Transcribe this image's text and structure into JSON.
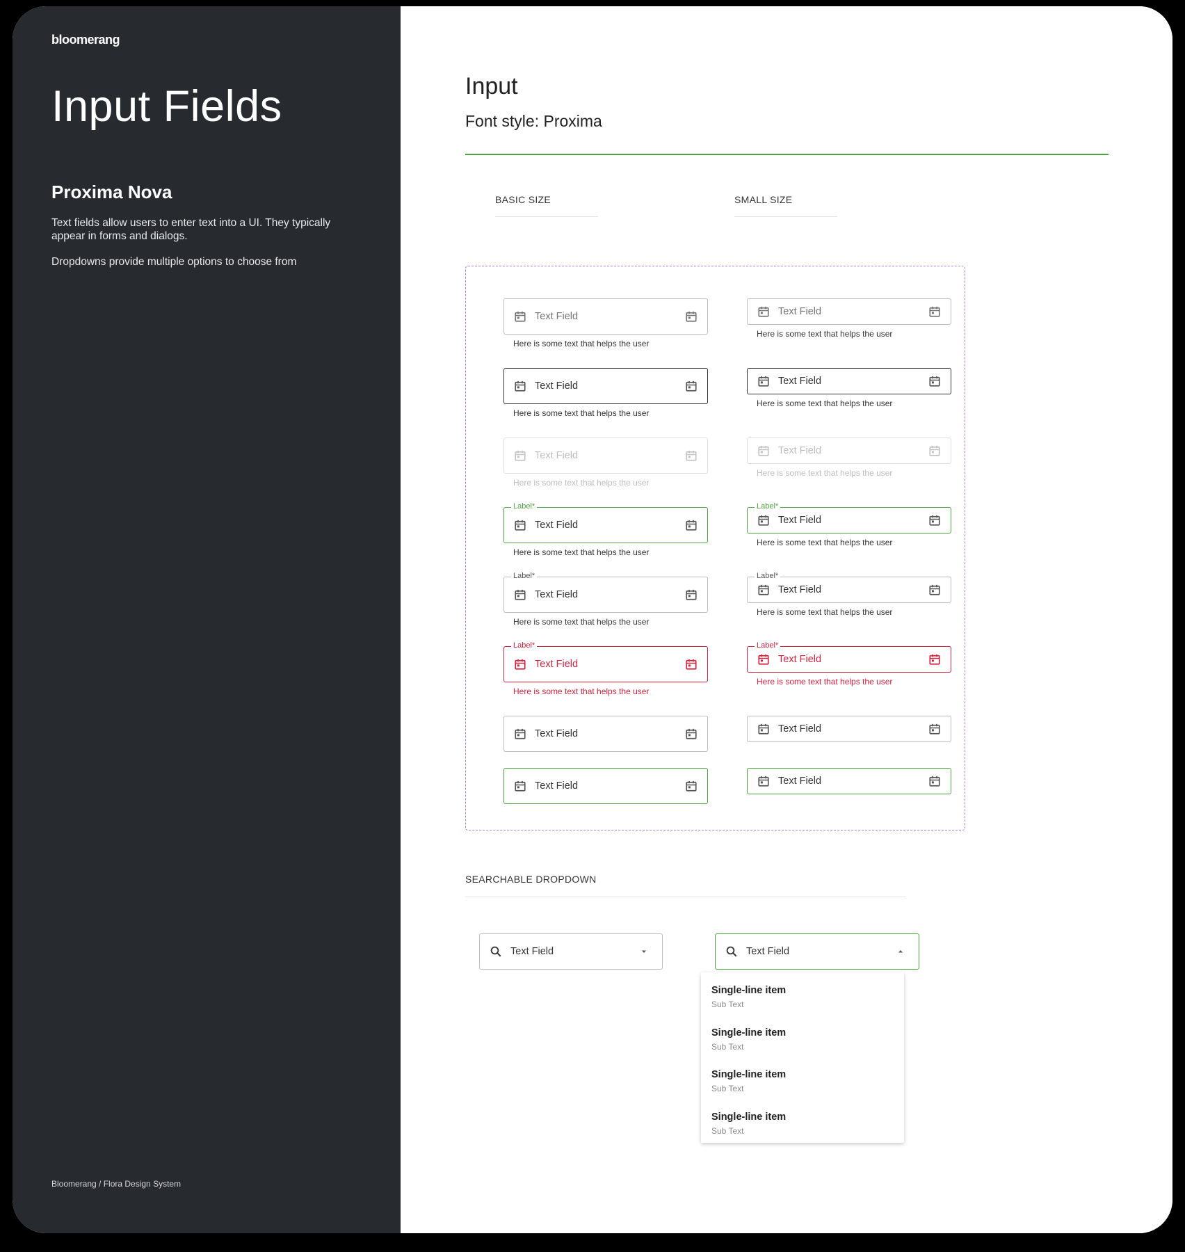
{
  "brand": "bloomerang",
  "sidebar": {
    "title": "Input Fields",
    "font_name": "Proxima Nova",
    "description_1": "Text fields allow users to enter text into a UI. They typically appear in forms and dialogs.",
    "description_2": "Dropdowns provide multiple options to choose from",
    "footer": "Bloomerang / Flora Design System"
  },
  "main": {
    "title": "Input",
    "subtitle": "Font style: Proxima",
    "col_basic": "BASIC SIZE",
    "col_small": "SMALL SIZE",
    "field_value": "Text Field",
    "label": "Label*",
    "helper": "Here is some text that helps the user",
    "dropdown_heading": "SEARCHABLE DROPDOWN",
    "dropdown_value": "Text Field",
    "menu_items": [
      {
        "title": "Single-line item",
        "sub": "Sub Text"
      },
      {
        "title": "Single-line item",
        "sub": "Sub Text"
      },
      {
        "title": "Single-line item",
        "sub": "Sub Text"
      },
      {
        "title": "Single-line item",
        "sub": "Sub Text"
      }
    ]
  },
  "colors": {
    "sidebar_bg": "#272a2f",
    "accent_green": "#4ca540",
    "error_red": "#d6223f",
    "dashed_purple": "#b57bd8"
  },
  "icons": {
    "field_left": "calendar-icon",
    "field_right": "calendar-icon",
    "dropdown_left": "search-icon",
    "dropdown_closed": "caret-down-icon",
    "dropdown_open": "caret-up-icon"
  }
}
